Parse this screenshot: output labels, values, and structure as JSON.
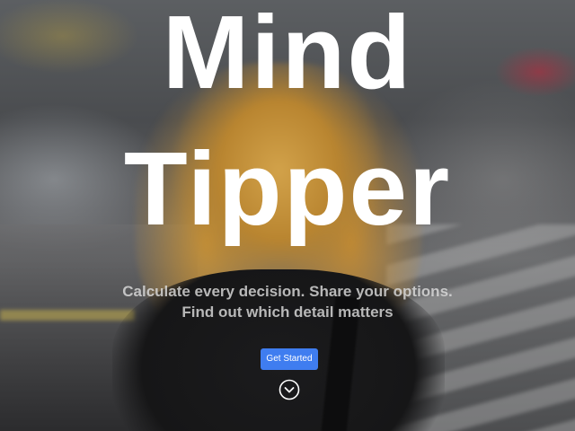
{
  "hero": {
    "title_line1": "Mind",
    "title_line2": "Tipper",
    "tagline_line1": "Calculate every decision. Share your options.",
    "tagline_line2": "Find out which detail matters",
    "cta_label": "Get Started",
    "scroll_icon": "chevron-down-circle-icon"
  },
  "colors": {
    "accent": "#3f7df0",
    "title_text": "#ffffff",
    "tagline_text": "#dcdcdc"
  }
}
